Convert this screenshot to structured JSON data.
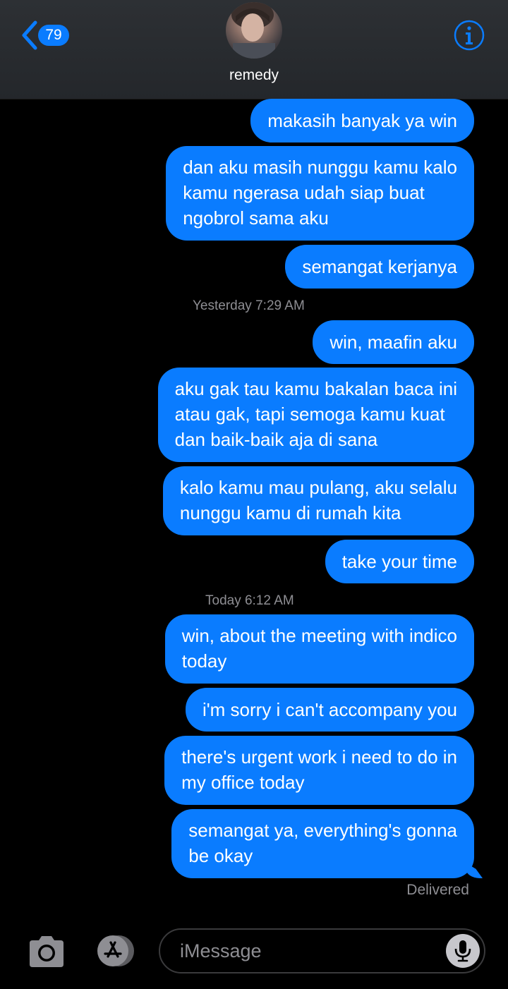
{
  "header": {
    "back_count": "79",
    "contact_name": "remedy"
  },
  "messages": [
    {
      "text": "makasih banyak ya win"
    },
    {
      "text": "dan aku masih nunggu kamu kalo\nkamu ngerasa udah siap buat\nngobrol sama aku"
    },
    {
      "text": "semangat kerjanya"
    },
    {
      "text": "win, maafin aku"
    },
    {
      "text": "aku gak tau kamu bakalan baca ini\natau gak, tapi semoga kamu kuat\ndan baik-baik aja di sana"
    },
    {
      "text": "kalo kamu mau pulang, aku selalu\nnunggu kamu di rumah kita"
    },
    {
      "text": "take your time"
    },
    {
      "text": "win, about the meeting with indico\ntoday"
    },
    {
      "text": "i'm sorry i can't accompany you"
    },
    {
      "text": "there's urgent work i need to do in\nmy office today"
    },
    {
      "text": "semangat ya, everything's gonna\nbe okay"
    }
  ],
  "timestamps": [
    {
      "prefix": "Yesterday",
      "time": "7:29 AM"
    },
    {
      "prefix": "Today",
      "time": "6:12 AM"
    }
  ],
  "status": "Delivered",
  "compose": {
    "placeholder": "iMessage"
  },
  "colors": {
    "bubble": "#0a7cff",
    "background": "#000000",
    "secondary_text": "#8e8e93"
  },
  "icons": [
    "chevron-left-icon",
    "info-icon",
    "camera-icon",
    "app-store-icon",
    "microphone-icon"
  ]
}
